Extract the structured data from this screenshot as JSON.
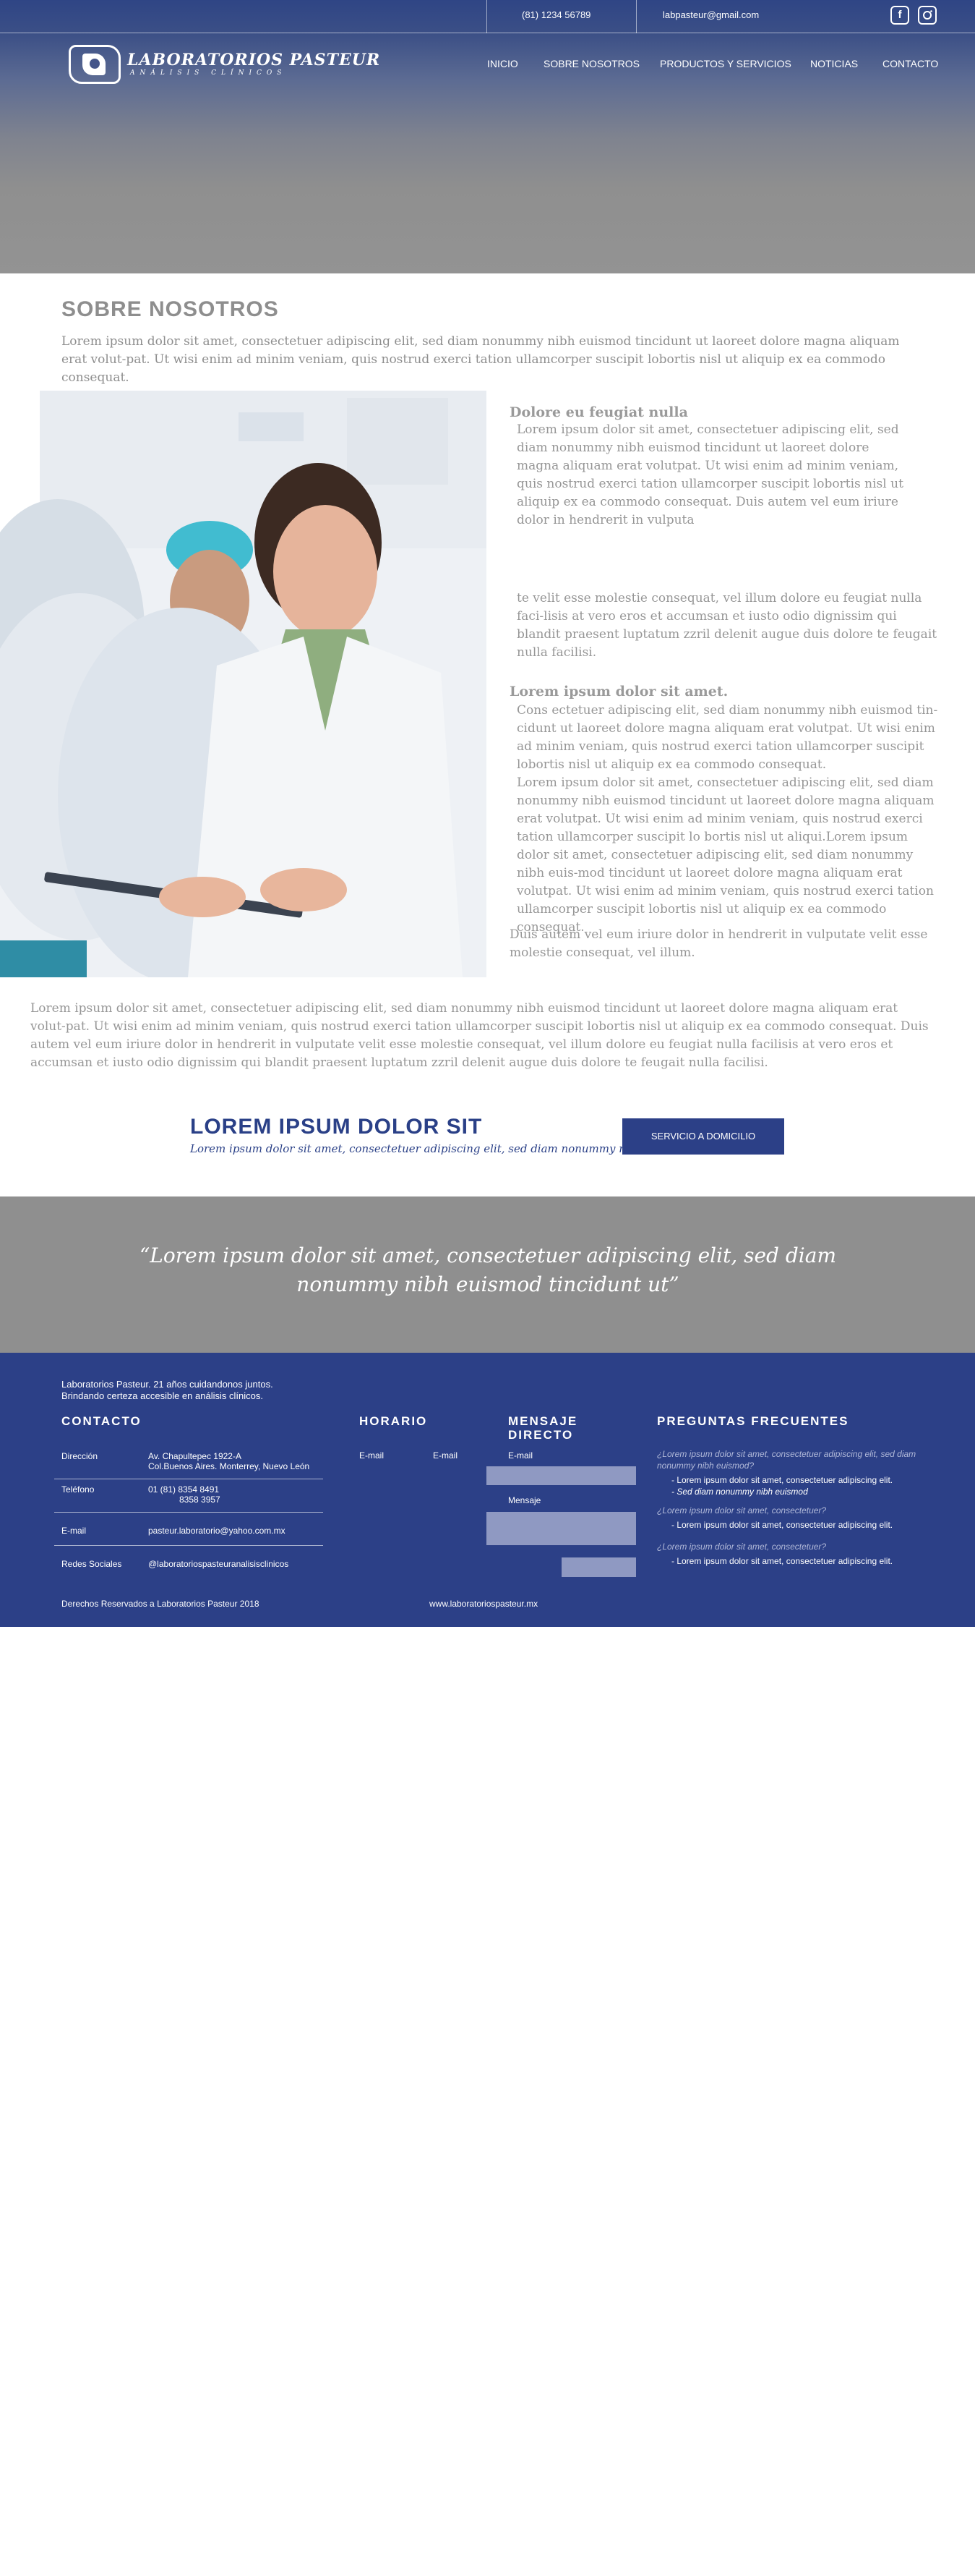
{
  "colors": {
    "brand_blue": "#2c4087",
    "header_gray": "#939393",
    "text_gray": "#969696",
    "field_gray": "#8f99c2"
  },
  "topbar": {
    "phone": "(81)  1234  56789",
    "email": "labpasteur@gmail.com",
    "social_icons": [
      "facebook-icon",
      "instagram-icon"
    ]
  },
  "logo": {
    "title": "LABORATORIOS PASTEUR",
    "subtitle": "ANÁLISIS CLÍNICOS"
  },
  "nav": {
    "items": [
      "INICIO",
      "SOBRE NOSOTROS",
      "PRODUCTOS Y SERVICIOS",
      "NOTICIAS",
      "CONTACTO"
    ]
  },
  "about": {
    "title": "SOBRE NOSOTROS",
    "lead": "Lorem ipsum dolor sit amet, consectetuer adipiscing elit, sed diam nonummy nibh euismod tincidunt ut laoreet dolore magna aliquam erat volut-pat. Ut wisi enim ad minim veniam, quis nostrud exerci tation ullamcorper suscipit lobortis nisl ut aliquip ex ea commodo consequat.",
    "heading1": "Dolore eu feugiat nulla",
    "para1": "Lorem ipsum dolor sit amet, consectetuer adipiscing elit, sed diam nonummy nibh euismod tincidunt ut laoreet dolore magna aliquam erat volutpat. Ut wisi enim ad minim veniam, quis nostrud exerci tation ullamcorper suscipit lobortis nisl ut aliquip ex ea commodo consequat. Duis autem vel eum iriure dolor in hendrerit in vulputa",
    "para2": "te velit esse molestie consequat, vel illum dolore eu feugiat nulla faci-lisis at vero eros et accumsan et iusto odio dignissim qui blandit praesent luptatum zzril delenit augue duis dolore te feugait nulla facilisi.",
    "heading2": "Lorem ipsum dolor sit amet.",
    "para3": "Cons ectetuer adipiscing elit, sed diam nonummy nibh euismod tin-cidunt ut laoreet dolore magna aliquam erat volutpat. Ut wisi enim ad minim veniam, quis nostrud exerci tation ullamcorper suscipit lobortis nisl ut aliquip ex ea commodo consequat.",
    "para4": "Lorem ipsum dolor sit amet, consectetuer adipiscing elit, sed diam nonummy nibh euismod tincidunt ut laoreet dolore magna aliquam erat volutpat. Ut wisi enim ad minim veniam, quis nostrud exerci tation ullamcorper suscipit lo bortis nisl ut aliqui.Lorem ipsum dolor sit amet, consectetuer adipiscing elit, sed diam nonummy nibh euis-mod tincidunt ut laoreet dolore magna aliquam erat volutpat. Ut wisi enim ad minim veniam, quis nostrud exerci tation ullamcorper suscipit lobortis nisl ut aliquip ex ea commodo consequat.",
    "para5": "Duis autem vel eum iriure dolor in hendrerit in vulputate velit esse molestie consequat, vel illum.",
    "bottom": "Lorem ipsum dolor sit amet, consectetuer adipiscing elit, sed diam nonummy nibh euismod tincidunt ut laoreet dolore magna aliquam erat volut-pat. Ut wisi enim ad minim veniam, quis nostrud exerci tation ullamcorper suscipit lobortis nisl ut aliquip ex ea commodo consequat. Duis autem vel eum iriure dolor in hendrerit in vulputate velit esse molestie consequat, vel illum dolore eu feugiat nulla facilisis at vero eros et accumsan et iusto odio dignissim qui blandit praesent luptatum zzril delenit augue duis dolore te feugait nulla facilisi."
  },
  "cta": {
    "title": "LOREM IPSUM DOLOR SIT",
    "subtitle": "Lorem ipsum dolor sit amet, consectetuer adipiscing elit, sed diam nonummy nibh.",
    "button": "SERVICIO A DOMICILIO"
  },
  "quote": {
    "text": "“Lorem ipsum dolor sit amet, consectetuer adipiscing elit, sed diam nonummy nibh euismod tincidunt ut”"
  },
  "footer": {
    "tagline1": "Laboratorios Pasteur. 21 años cuidandonos juntos.",
    "tagline2": "Brindando certeza accesible en análisis clínicos.",
    "contact_title": "CONTACTO",
    "direccion_label": "Dirección",
    "direccion_1": "Av. Chapultepec 1922-A",
    "direccion_2": "Col.Buenos Aires. Monterrey, Nuevo León",
    "telefono_label": "Teléfono",
    "telefono_1": "01 (81)  8354  8491",
    "telefono_2": "8358  3957",
    "email_label": "E-mail",
    "email_value": "pasteur.laboratorio@yahoo.com.mx",
    "redes_label": "Redes Sociales",
    "redes_value": "@laboratoriospasteuranalisisclinicos",
    "horario_title": "HORARIO",
    "horario_col1": "E-mail",
    "horario_col2": "E-mail",
    "mensaje_title_1": "MENSAJE",
    "mensaje_title_2": "DIRECTO",
    "form_email_label": "E-mail",
    "form_message_label": "Mensaje",
    "faq_title": "PREGUNTAS FRECUENTES",
    "faq1_q": "¿Lorem ipsum dolor sit amet, consectetuer adipiscing elit, sed diam nonummy nibh euismod?",
    "faq1_a1": "- Lorem ipsum dolor sit amet, consectetuer adipiscing elit.",
    "faq1_a2": "- Sed diam nonummy nibh euismod",
    "faq2_q": "¿Lorem ipsum dolor sit amet, consectetuer?",
    "faq2_a": "- Lorem ipsum dolor sit amet, consectetuer adipiscing elit.",
    "faq3_q": "¿Lorem ipsum dolor sit amet, consectetuer?",
    "faq3_a": "- Lorem ipsum dolor sit amet, consectetuer adipiscing elit.",
    "copyright": "Derechos Reservados a Laboratorios Pasteur   2018",
    "website": "www.laboratoriospasteur.mx"
  }
}
